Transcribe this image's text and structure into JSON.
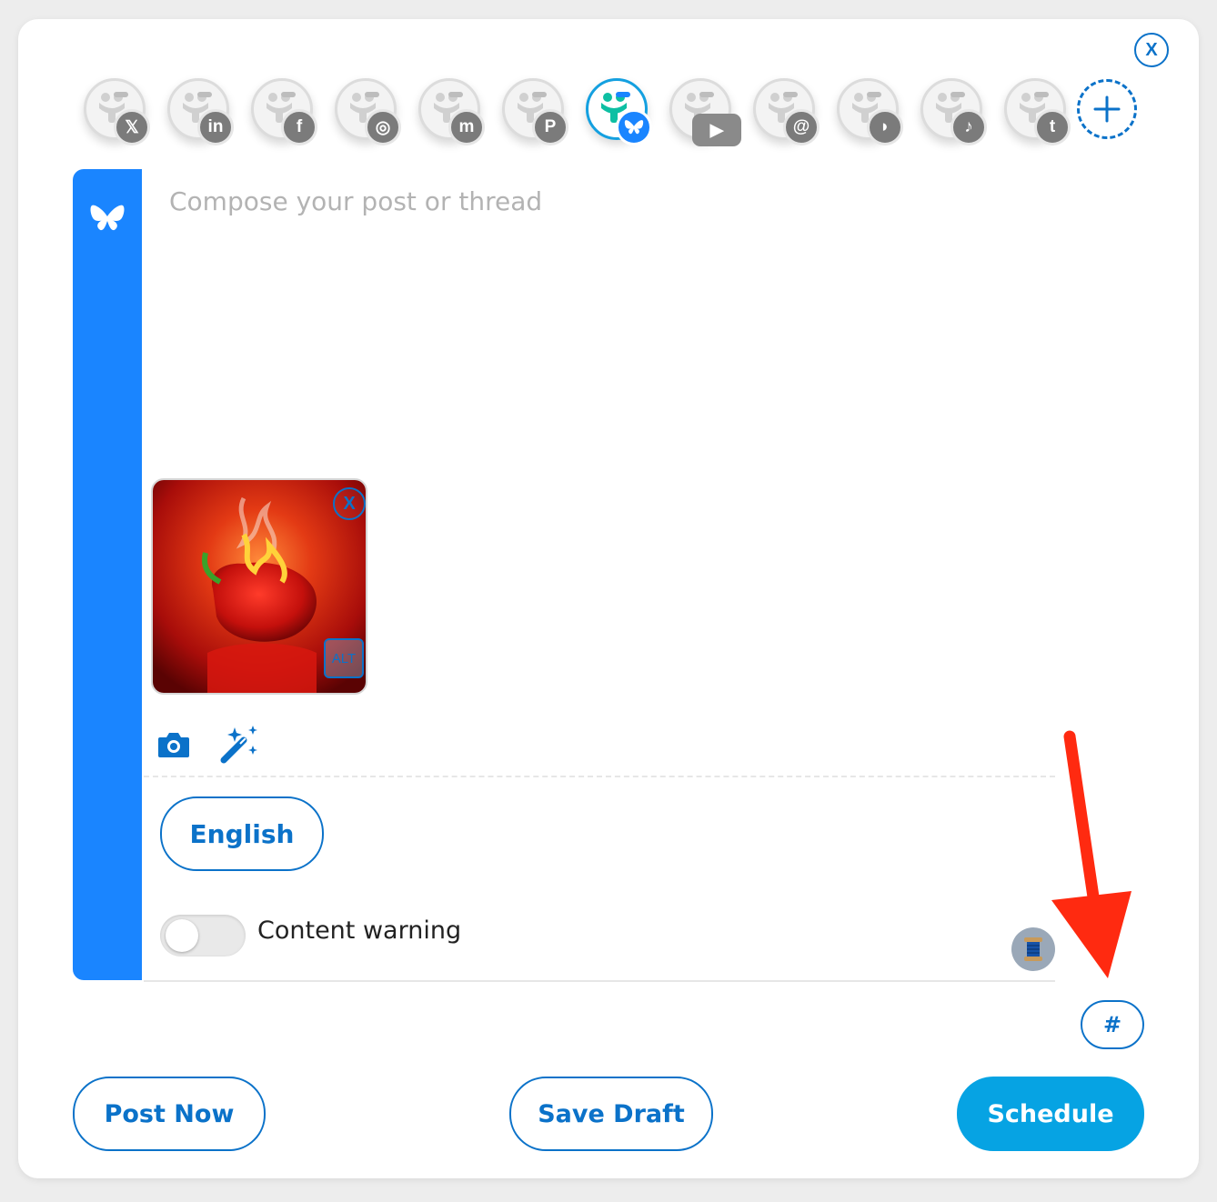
{
  "header": {
    "close_label": "X",
    "add_account_label": "+"
  },
  "accounts": [
    {
      "network": "x",
      "badge_icon": "x-logo-icon",
      "badge_text": "𝕏",
      "active": false
    },
    {
      "network": "linkedin",
      "badge_icon": "linkedin-icon",
      "badge_text": "in",
      "active": false
    },
    {
      "network": "facebook",
      "badge_icon": "facebook-icon",
      "badge_text": "f",
      "active": false
    },
    {
      "network": "instagram",
      "badge_icon": "instagram-icon",
      "badge_text": "◎",
      "active": false
    },
    {
      "network": "mastodon",
      "badge_icon": "mastodon-icon",
      "badge_text": "m",
      "active": false
    },
    {
      "network": "pinterest",
      "badge_icon": "pinterest-icon",
      "badge_text": "P",
      "active": false
    },
    {
      "network": "bluesky",
      "badge_icon": "bluesky-butterfly-icon",
      "badge_text": "",
      "active": true
    },
    {
      "network": "youtube",
      "badge_icon": "youtube-icon",
      "badge_text": "▶",
      "active": false
    },
    {
      "network": "threads",
      "badge_icon": "threads-icon",
      "badge_text": "@",
      "active": false
    },
    {
      "network": "google-business",
      "badge_icon": "speech-bubble-icon",
      "badge_text": "◗",
      "active": false
    },
    {
      "network": "tiktok",
      "badge_icon": "tiktok-icon",
      "badge_text": "♪",
      "active": false
    },
    {
      "network": "tumblr",
      "badge_icon": "tumblr-icon",
      "badge_text": "t",
      "active": false
    }
  ],
  "composer": {
    "network_icon": "bluesky-butterfly-icon",
    "placeholder": "Compose your post or thread",
    "value": "",
    "media": {
      "remove_label": "X",
      "alt_label": "ALT",
      "image_icon": "red-pepper-on-fire-image"
    },
    "tools": [
      "camera-icon",
      "magic-wand-icon"
    ],
    "language_label": "English",
    "content_warning_label": "Content warning",
    "content_warning_on": false,
    "thread_icon": "thread-spool-icon"
  },
  "hashtag_label": "#",
  "footer": {
    "post_now_label": "Post Now",
    "save_draft_label": "Save Draft",
    "schedule_label": "Schedule"
  },
  "annotation": {
    "arrow_icon": "red-arrow-annotation-icon",
    "arrow_color": "#ff2a10"
  },
  "colors": {
    "accent": "#0b72c9",
    "bluesky": "#1a85ff",
    "schedule": "#06a3e3"
  }
}
